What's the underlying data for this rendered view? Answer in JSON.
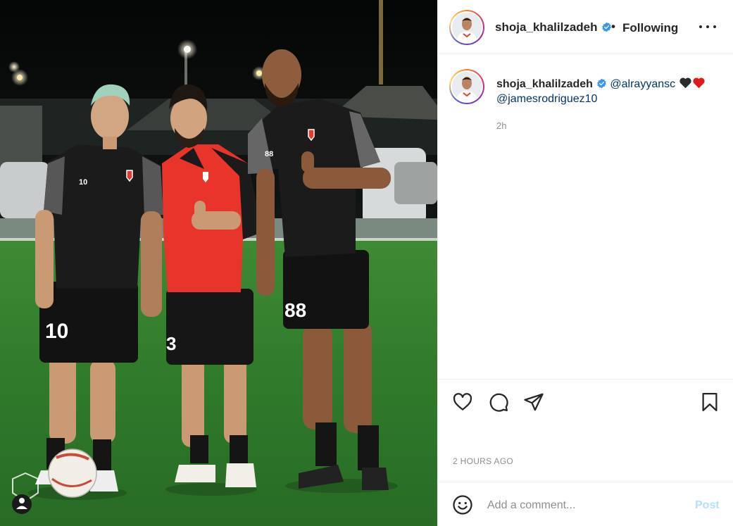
{
  "post": {
    "username": "shoja_khalilzadeh",
    "follow_separator": "•",
    "follow_status": "Following",
    "caption": {
      "username": "shoja_khalilzadeh",
      "mention_1": "@alrayyansc",
      "mention_2": "@jamesrodriguez10",
      "emojis": [
        "black-heart",
        "red-heart"
      ],
      "relative_time": "2h"
    },
    "timestamp": "2 HOURS AGO"
  },
  "photo": {
    "players": [
      {
        "shirt_number": "10",
        "shorts_number": "10"
      },
      {
        "shorts_number": "3"
      },
      {
        "shirt_number": "88",
        "shorts_number": "88"
      }
    ]
  },
  "actions": {
    "icons": [
      "heart-icon",
      "comment-icon",
      "share-icon",
      "bookmark-icon"
    ]
  },
  "comment": {
    "placeholder": "Add a comment...",
    "post_label": "Post"
  },
  "colors": {
    "verified": "#3897f0",
    "link": "#00376b",
    "post_button_disabled": "#b2dffc",
    "muted_text": "#8e8e8e"
  }
}
